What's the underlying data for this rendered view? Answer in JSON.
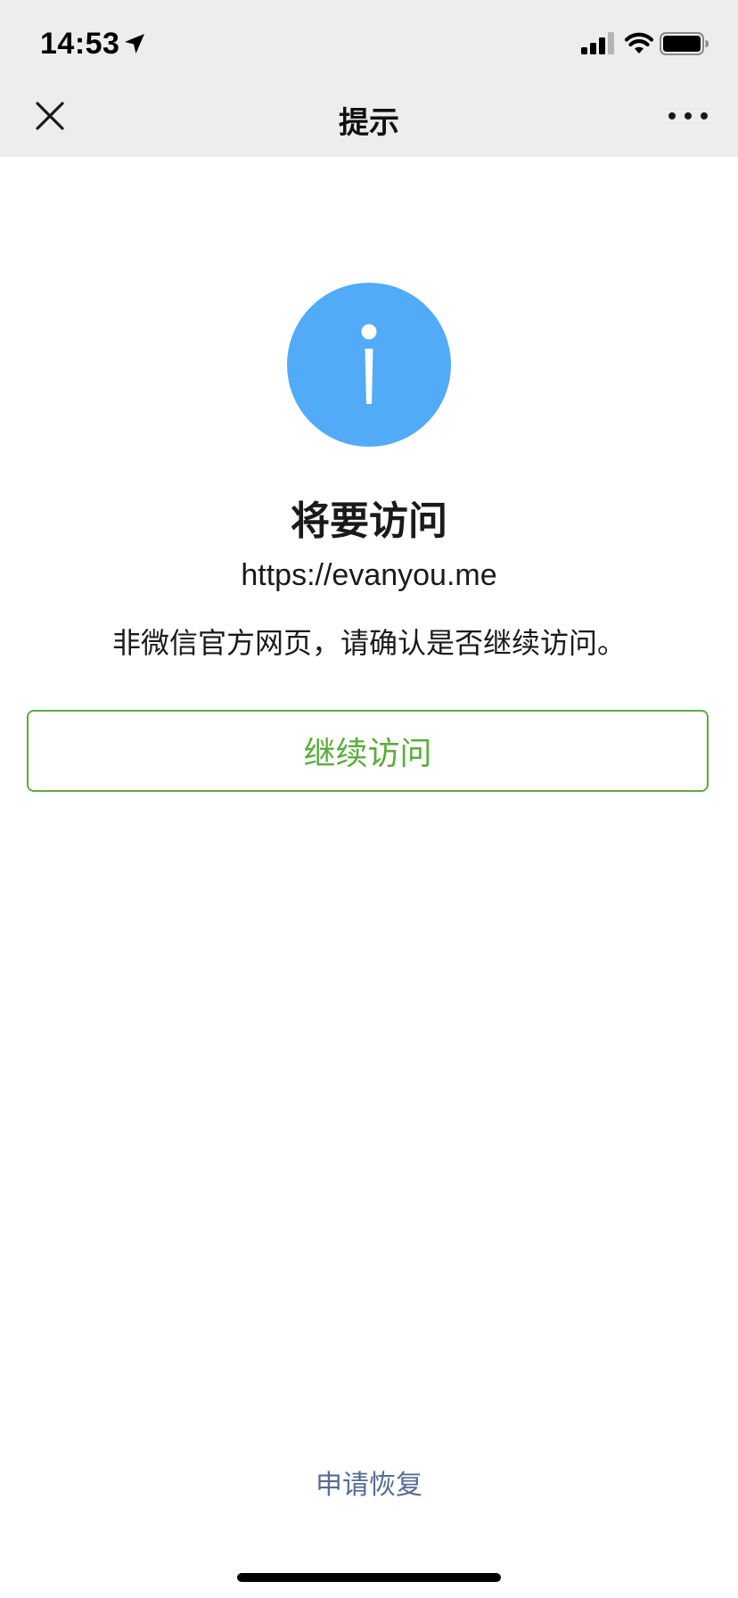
{
  "status_bar": {
    "time": "14:53",
    "icons": [
      "location-arrow-icon",
      "cellular-signal-icon",
      "wifi-icon",
      "battery-icon"
    ]
  },
  "nav": {
    "title": "提示",
    "left_icon": "close-icon",
    "right_icon": "more-icon"
  },
  "content": {
    "icon": "info-icon",
    "heading": "将要访问",
    "url": "https://evanyou.me",
    "warning": "非微信官方网页，请确认是否继续访问。",
    "continue_label": "继续访问"
  },
  "footer": {
    "restore_label": "申请恢复"
  },
  "colors": {
    "nav_background": "#ededed",
    "info_icon": "#52abf7",
    "primary_green": "#5aad3c",
    "link_blue": "#576b95"
  }
}
